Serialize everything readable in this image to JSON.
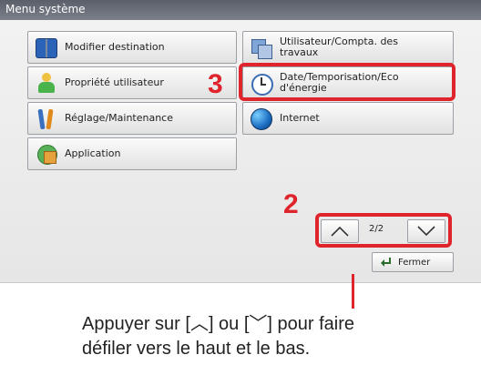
{
  "window": {
    "title": "Menu système"
  },
  "buttons": {
    "modifier_destination": "Modifier destination",
    "propriete_utilisateur": "Propriété utilisateur",
    "reglage_maintenance": "Réglage/Maintenance",
    "application": "Application",
    "utilisateur_compta": "Utilisateur/Compta. des\ntravaux",
    "date_temporisation": "Date/Temporisation/Eco\nd'énergie",
    "internet": "Internet"
  },
  "pager": {
    "page": "2/2"
  },
  "close": {
    "label": "Fermer"
  },
  "annotations": {
    "step3": "3",
    "step2": "2",
    "caption": "Appuyer sur [︿] ou [﹀] pour faire\ndéfiler vers le haut et le bas."
  },
  "colors": {
    "highlight": "#e0242c",
    "titlebar": "#6a6f79"
  },
  "icons": {
    "modifier_destination": "address-book-icon",
    "propriete_utilisateur": "user-icon",
    "reglage_maintenance": "tools-icon",
    "application": "application-icon",
    "utilisateur_compta": "accounting-icon",
    "date_temporisation": "clock-icon",
    "internet": "globe-icon",
    "up": "chevron-up-icon",
    "down": "chevron-down-icon",
    "close": "return-icon"
  }
}
